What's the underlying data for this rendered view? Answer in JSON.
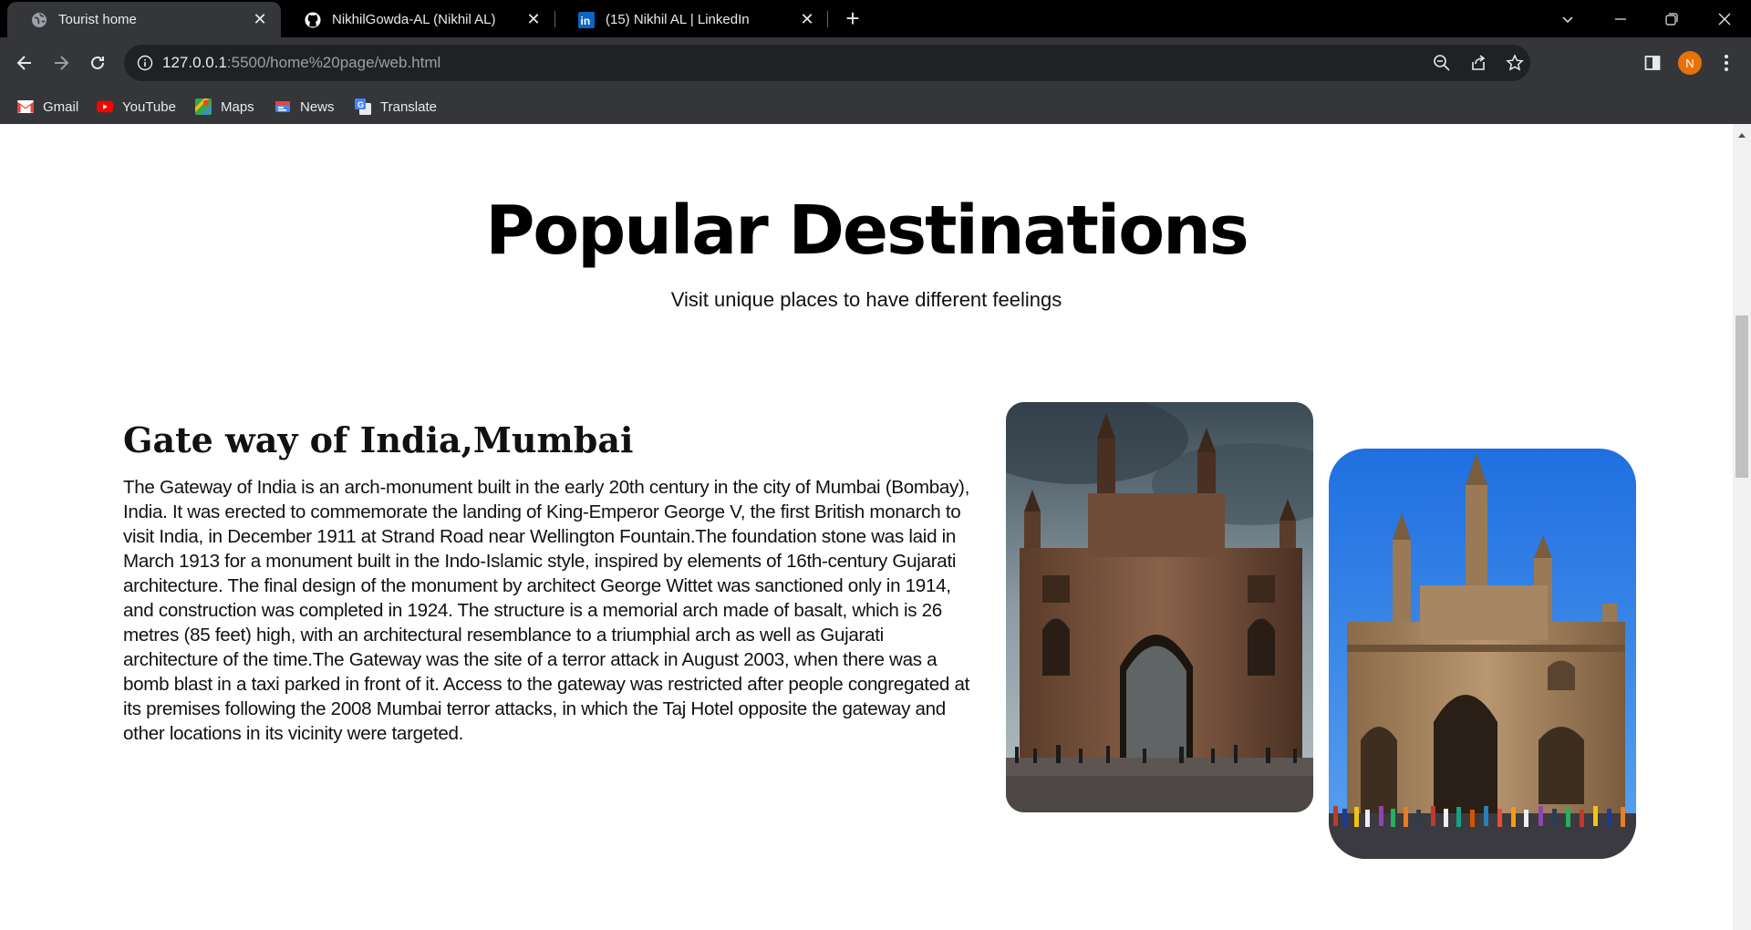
{
  "browser": {
    "tabs": [
      {
        "title": "Tourist home",
        "icon": "globe-icon",
        "active": true
      },
      {
        "title": "NikhilGowda-AL (Nikhil AL)",
        "icon": "github-icon",
        "active": false
      },
      {
        "title": "(15) Nikhil AL | LinkedIn",
        "icon": "linkedin-icon",
        "active": false
      }
    ],
    "address": {
      "host": "127.0.0.1",
      "rest": ":5500/home%20page/web.html"
    },
    "profile_initial": "N",
    "bookmarks": [
      {
        "label": "Gmail",
        "icon": "gmail-icon"
      },
      {
        "label": "YouTube",
        "icon": "youtube-icon"
      },
      {
        "label": "Maps",
        "icon": "maps-icon"
      },
      {
        "label": "News",
        "icon": "news-icon"
      },
      {
        "label": "Translate",
        "icon": "translate-icon"
      }
    ]
  },
  "page": {
    "title": "Popular Destinations",
    "subtitle": "Visit unique places to have different feelings",
    "destination": {
      "heading": "Gate way of India,Mumbai",
      "description": "The Gateway of India is an arch-monument built in the early 20th century in the city of Mumbai (Bombay), India. It was erected to commemorate the landing of King-Emperor George V, the first British monarch to visit India, in December 1911 at Strand Road near Wellington Fountain.The foundation stone was laid in March 1913 for a monument built in the Indo-Islamic style, inspired by elements of 16th-century Gujarati architecture. The final design of the monument by architect George Wittet was sanctioned only in 1914, and construction was completed in 1924. The structure is a memorial arch made of basalt, which is 26 metres (85 feet) high, with an architectural resemblance to a triumphial arch as well as Gujarati architecture of the time.The Gateway was the site of a terror attack in August 2003, when there was a bomb blast in a taxi parked in front of it. Access to the gateway was restricted after people congregated at its premises following the 2008 Mumbai terror attacks, in which the Taj Hotel opposite the gateway and other locations in its vicinity were targeted."
    }
  },
  "colors": {
    "tabbar": "#000000",
    "toolbar": "#35363a",
    "profile": "#e8710a"
  }
}
